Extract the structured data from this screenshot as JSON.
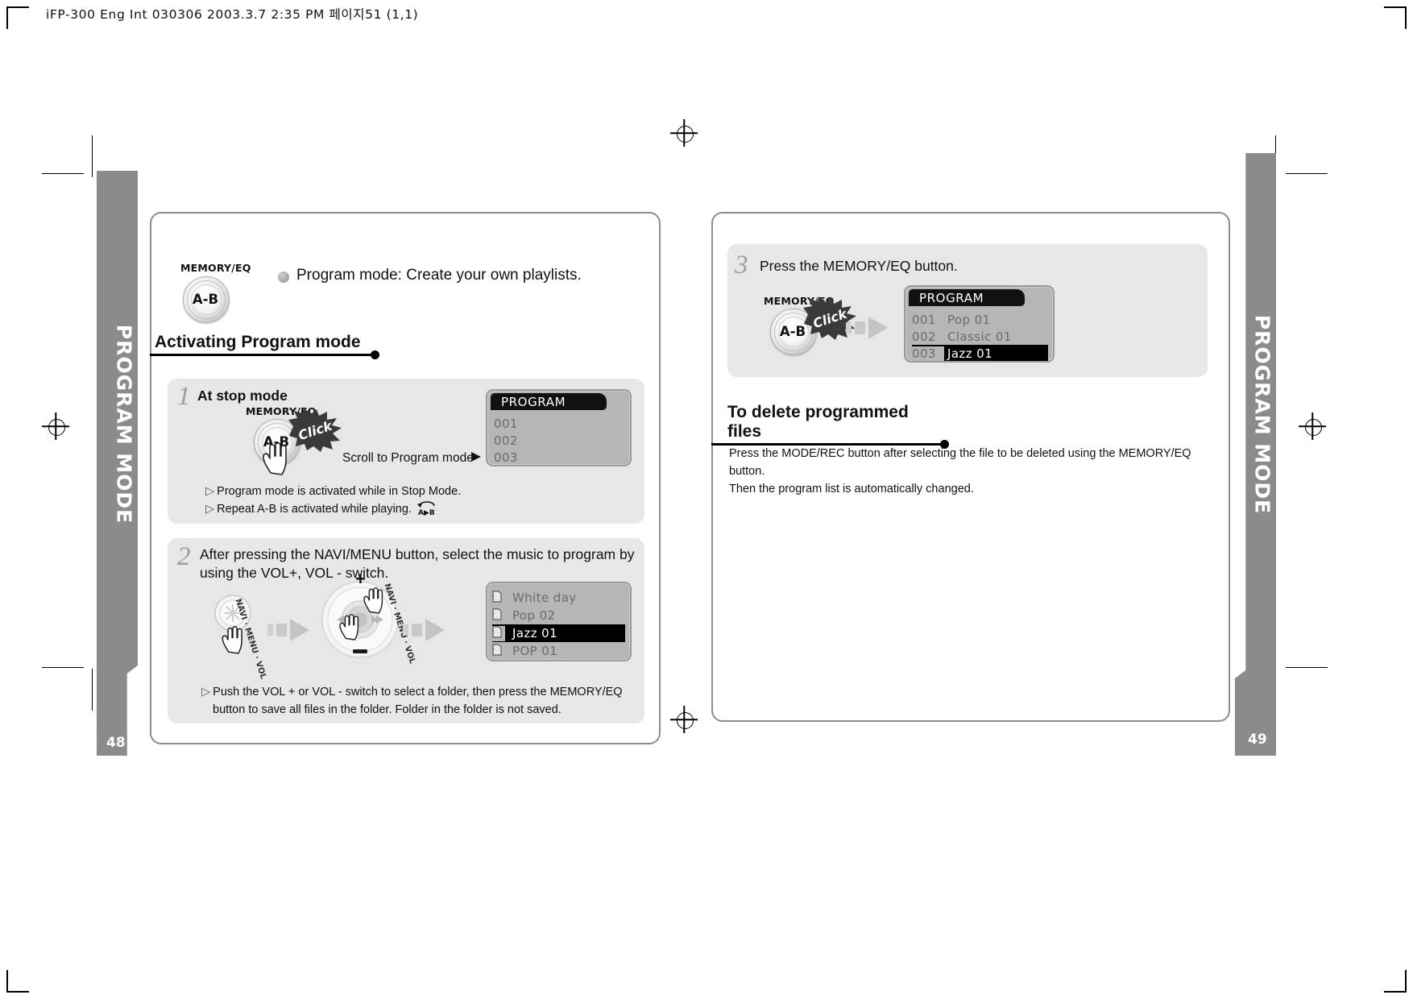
{
  "file_header": "iFP-300 Eng Int 030306  2003.3.7 2:35 PM 페이지51 (1,1)",
  "side_tabs": {
    "left": {
      "label": "PROGRAM MODE",
      "page_number": "48"
    },
    "right": {
      "label": "PROGRAM MODE",
      "page_number": "49"
    }
  },
  "left_page": {
    "intro": {
      "button_label": "MEMORY/EQ",
      "button_text": "A-B",
      "description": "Program mode: Create your own playlists."
    },
    "section_title": "Activating Program mode",
    "step1": {
      "number": "1",
      "title": "At stop mode",
      "button_label": "MEMORY/EQ",
      "button_text": "A-B",
      "click_label": "Click",
      "scroll_label": "Scroll to Program mode",
      "scroll_arrow": "▶",
      "screen": {
        "title": "PROGRAM",
        "rows": [
          {
            "index": "001",
            "name": "",
            "selected": false
          },
          {
            "index": "002",
            "name": "",
            "selected": false
          },
          {
            "index": "003",
            "name": "",
            "selected": false
          }
        ]
      },
      "notes": [
        "Program mode is activated while in Stop Mode.",
        "Repeat A-B is activated while playing."
      ],
      "ab_icon_label": "A▶B"
    },
    "step2": {
      "number": "2",
      "title_line1": "After pressing the NAVI/MENU button, select the music to program by",
      "title_line2": "using the VOL+, VOL - switch.",
      "joystick_label_left": "NAVI · MENU · VOL",
      "joystick_label_right": "NAVI · MENU · VOL",
      "plus_label": "+",
      "minus_label": "−",
      "screen_rows": [
        {
          "name": "White day",
          "selected": false
        },
        {
          "name": "Pop 02",
          "selected": false
        },
        {
          "name": "Jazz 01",
          "selected": true
        },
        {
          "name": "POP 01",
          "selected": false
        }
      ],
      "note_line1": "Push the VOL + or VOL - switch to select a folder, then press the MEMORY/EQ",
      "note_line2": "button to save all files in the folder. Folder in the folder is not saved."
    }
  },
  "right_page": {
    "step3": {
      "number": "3",
      "title": "Press the MEMORY/EQ button.",
      "button_label": "MEMORY/EQ",
      "button_text": "A-B",
      "click_label": "Click",
      "screen": {
        "title": "PROGRAM",
        "rows": [
          {
            "index": "001",
            "name": "Pop 01",
            "selected": false
          },
          {
            "index": "002",
            "name": "Classic 01",
            "selected": false
          },
          {
            "index": "003",
            "name": "Jazz 01",
            "selected": true
          }
        ]
      }
    },
    "delete_section": {
      "title": "To delete programmed files",
      "body_line1": "Press the MODE/REC button after selecting the file to be deleted using the MEMORY/EQ",
      "body_line2": "button.",
      "body_line3": "Then the program list is automatically changed."
    }
  },
  "colors": {
    "tab_grey": "#8b8b8b",
    "panel_grey": "#e7e7e7",
    "lcd_grey": "#b6b6b6",
    "lcd_title_black": "#111111"
  }
}
